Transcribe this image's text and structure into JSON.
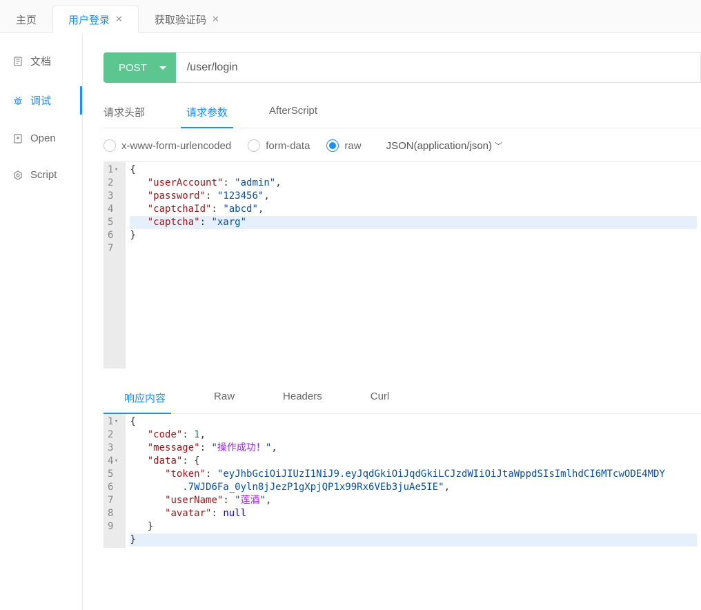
{
  "tabs": [
    {
      "label": "主页"
    },
    {
      "label": "用户登录",
      "closable": true,
      "active": true
    },
    {
      "label": "获取验证码",
      "closable": true
    }
  ],
  "sidebar": {
    "items": [
      {
        "label": "文档",
        "icon": "doc"
      },
      {
        "label": "调试",
        "icon": "bug",
        "active": true
      },
      {
        "label": "Open",
        "icon": "open"
      },
      {
        "label": "Script",
        "icon": "script"
      }
    ]
  },
  "request": {
    "method": "POST",
    "url": "/user/login",
    "tabs": [
      {
        "label": "请求头部"
      },
      {
        "label": "请求参数",
        "active": true
      },
      {
        "label": "AfterScript"
      }
    ],
    "bodyTypes": [
      {
        "label": "x-www-form-urlencoded"
      },
      {
        "label": "form-data"
      },
      {
        "label": "raw",
        "selected": true
      }
    ],
    "contentType": "JSON(application/json)",
    "body": {
      "lines": [
        {
          "n": "1",
          "fold": true,
          "text": "{"
        },
        {
          "n": "2",
          "text": "    \"userAccount\": \"admin\","
        },
        {
          "n": "3",
          "text": "    \"password\": \"123456\","
        },
        {
          "n": "4",
          "text": "    \"captchaId\": \"abcd\","
        },
        {
          "n": "5",
          "hl": true,
          "text": "    \"captcha\": \"xarg\""
        },
        {
          "n": "6",
          "text": "}"
        },
        {
          "n": "7",
          "text": ""
        }
      ],
      "json": {
        "userAccount": "admin",
        "password": "123456",
        "captchaId": "abcd",
        "captcha": "xarg"
      }
    }
  },
  "response": {
    "tabs": [
      {
        "label": "响应内容",
        "active": true
      },
      {
        "label": "Raw"
      },
      {
        "label": "Headers"
      },
      {
        "label": "Curl"
      }
    ],
    "body": {
      "lines": [
        {
          "n": "1",
          "fold": true
        },
        {
          "n": "2"
        },
        {
          "n": "3"
        },
        {
          "n": "4",
          "fold": true
        },
        {
          "n": "5"
        },
        {
          "n": ""
        },
        {
          "n": "6"
        },
        {
          "n": "7"
        },
        {
          "n": "8"
        },
        {
          "n": "9",
          "hl": true
        }
      ],
      "json": {
        "code": 1,
        "message": "操作成功！",
        "data": {
          "token": "eyJhbGciOiJIUzI1NiJ9.eyJqdGkiOiJqdGkiLCJzdWIiOiJtaWppdSIsImlhdCI6MTcwODE4MDY.7WJD6Fa_0yln8jJezP1gXpjQP1x99Rx6VEb3juAe5IE",
          "userName": "莲酒",
          "avatar": null
        }
      }
    }
  }
}
